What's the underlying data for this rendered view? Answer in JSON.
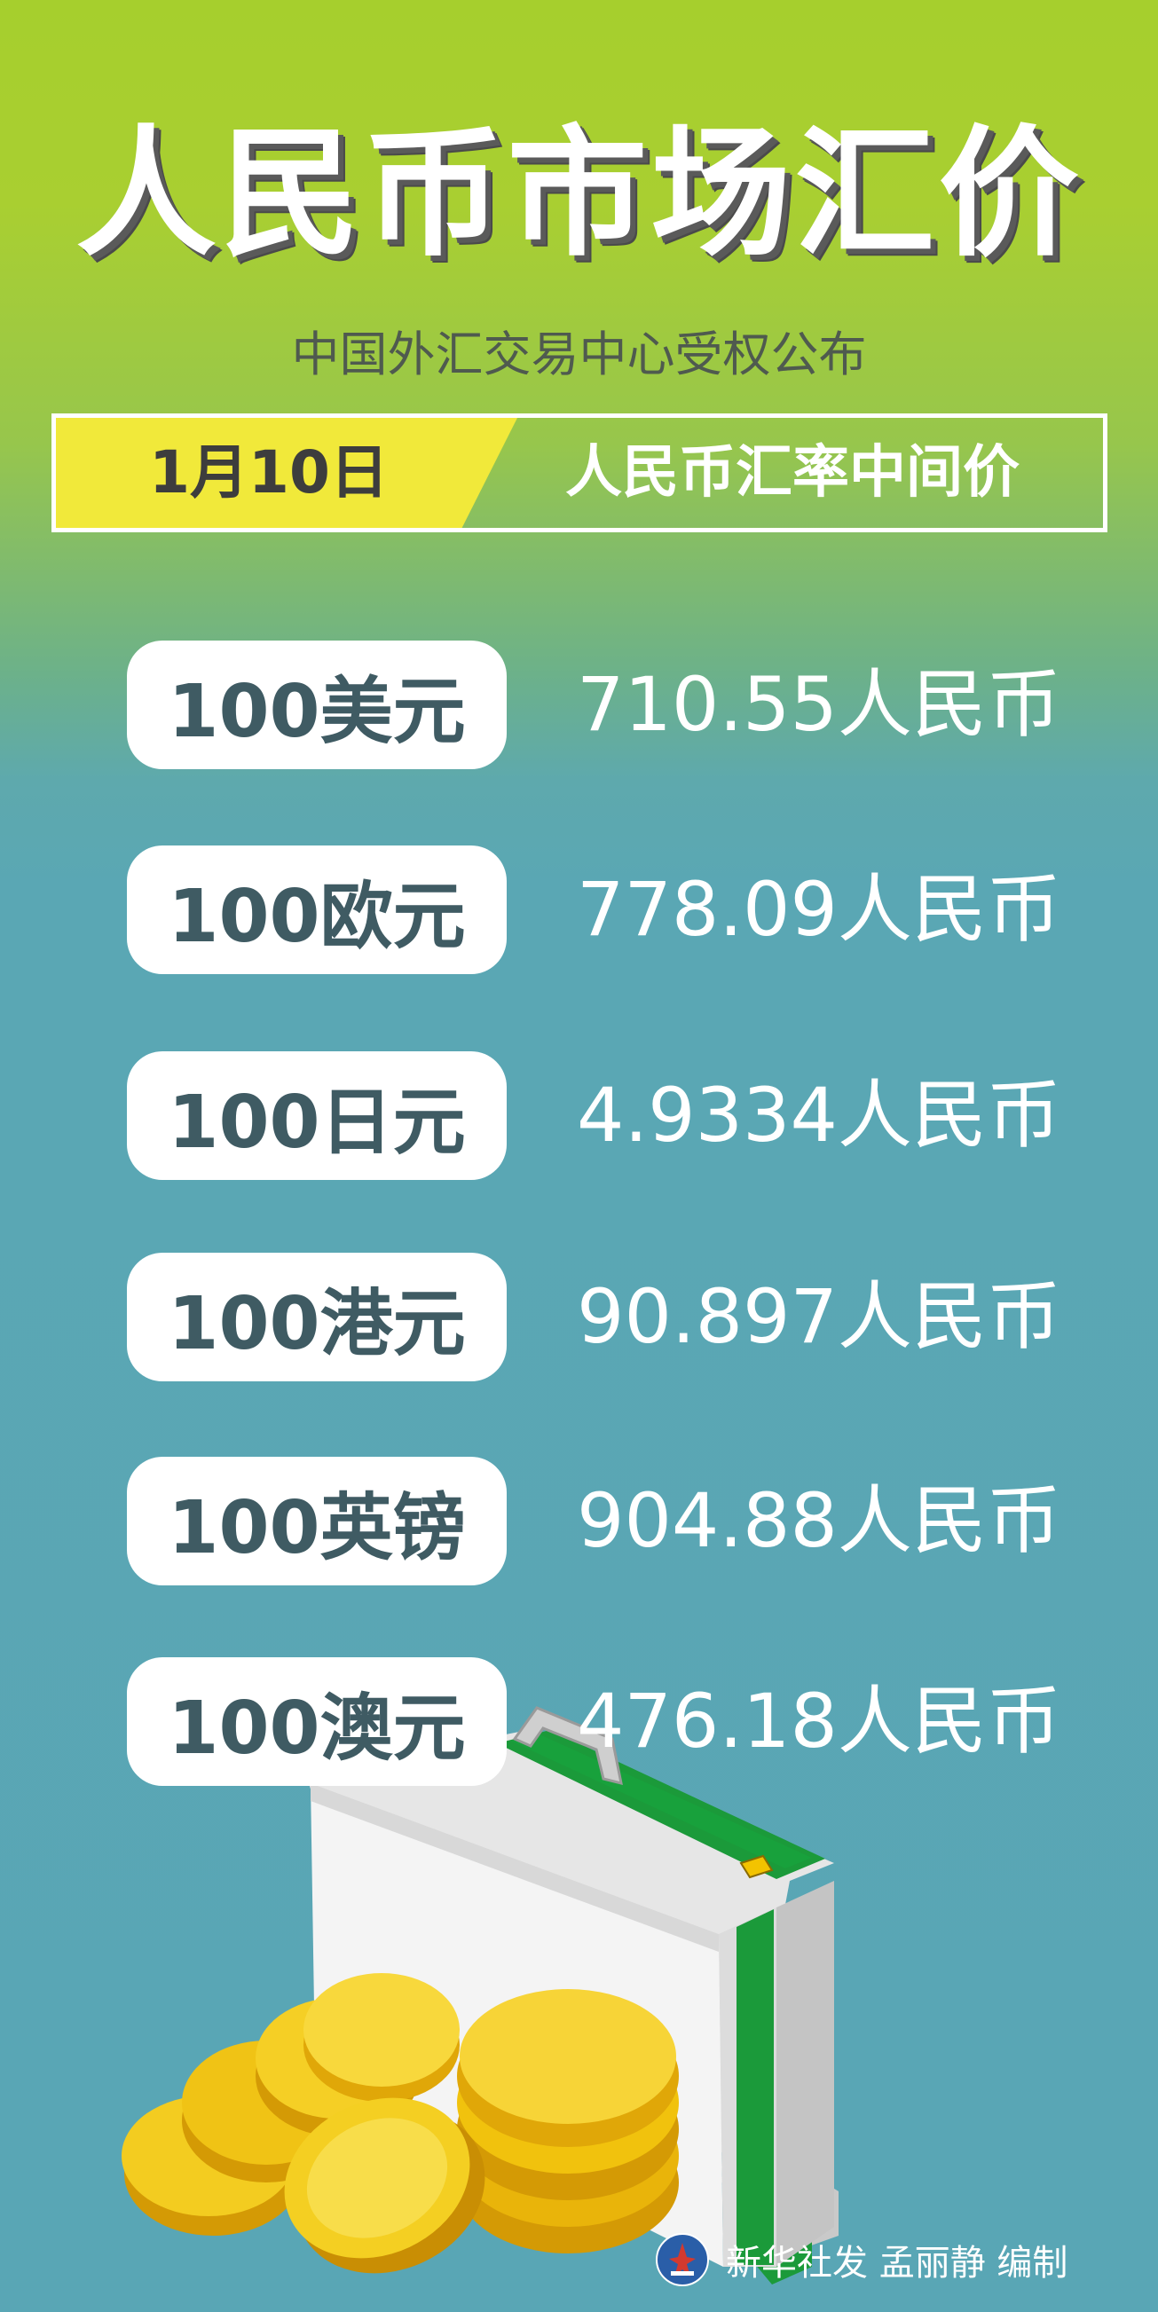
{
  "header": {
    "title": "人民币市场汇价",
    "subtitle": "中国外汇交易中心受权公布"
  },
  "banner": {
    "date": "1月10日",
    "label": "人民币汇率中间价"
  },
  "rates": [
    {
      "currency": "100美元",
      "value": "710.55人民币"
    },
    {
      "currency": "100欧元",
      "value": "778.09人民币"
    },
    {
      "currency": "100日元",
      "value": "4.9334人民币"
    },
    {
      "currency": "100港元",
      "value": "90.897人民币"
    },
    {
      "currency": "100英镑",
      "value": "904.88人民币"
    },
    {
      "currency": "100澳元",
      "value": "476.18人民币"
    }
  ],
  "footer": {
    "credit": "新华社发 孟丽静 编制",
    "logo_icon": "xinhua-logo-icon"
  },
  "colors": {
    "background_top": "#a6cf2d",
    "background_bottom": "#59a6b5",
    "banner_date_bg": "#f1e93a",
    "pill_text": "#3f5b63"
  },
  "illustration": {
    "icons": [
      "briefcase-icon",
      "gold-coins-icon"
    ]
  }
}
